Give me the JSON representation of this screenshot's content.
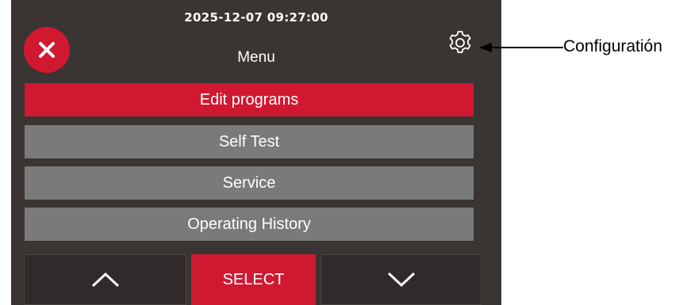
{
  "screen": {
    "datetime": "2025-12-07 09:27:00",
    "title": "Menu",
    "icons": {
      "close": "close-icon",
      "settings": "gear-icon"
    },
    "menu_items": [
      {
        "label": "Edit programs",
        "selected": true
      },
      {
        "label": "Self Test",
        "selected": false
      },
      {
        "label": "Service",
        "selected": false
      },
      {
        "label": "Operating History",
        "selected": false
      }
    ],
    "bottom_bar": {
      "up_icon": "chevron-up-icon",
      "select_label": "SELECT",
      "down_icon": "chevron-down-icon"
    }
  },
  "annotation": {
    "label": "Configuratión"
  },
  "colors": {
    "accent": "#d01931",
    "panel": "#3a3433",
    "item": "#7a7a7a"
  }
}
